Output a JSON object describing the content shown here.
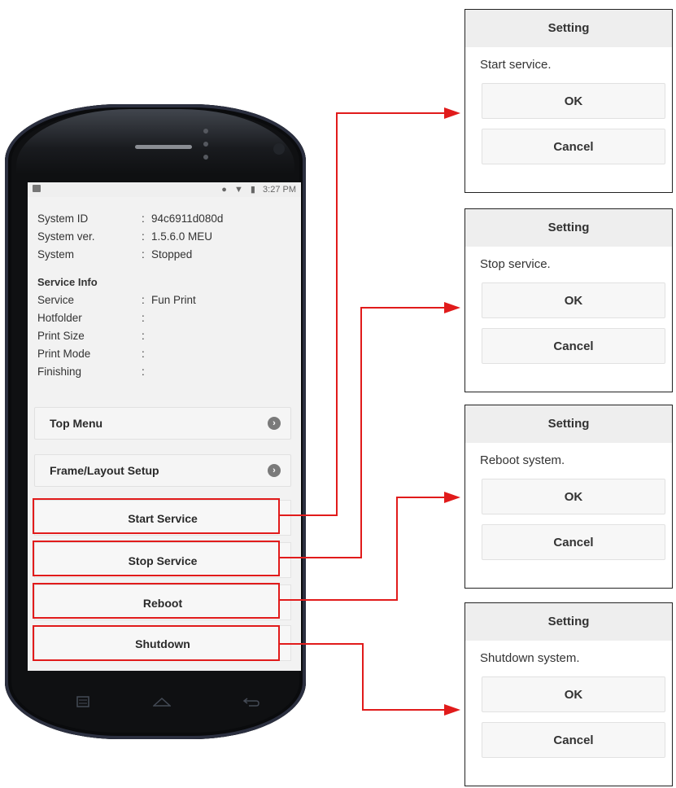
{
  "status_bar": {
    "time": "3:27 PM"
  },
  "system_info": [
    {
      "key": "System ID",
      "sep": ":",
      "value": "94c6911d080d"
    },
    {
      "key": "System ver.",
      "sep": ":",
      "value": "1.5.6.0 MEU"
    },
    {
      "key": "System",
      "sep": ":",
      "value": "Stopped"
    }
  ],
  "service_info": {
    "title": "Service Info",
    "rows": [
      {
        "key": "Service",
        "sep": ":",
        "value": "Fun Print"
      },
      {
        "key": "Hotfolder",
        "sep": ":",
        "value": ""
      },
      {
        "key": "Print Size",
        "sep": ":",
        "value": ""
      },
      {
        "key": "Print Mode",
        "sep": ":",
        "value": ""
      },
      {
        "key": "Finishing",
        "sep": ":",
        "value": ""
      }
    ]
  },
  "menu": {
    "top_menu": "Top Menu",
    "frame_layout": "Frame/Layout Setup"
  },
  "actions": {
    "start": "Start Service",
    "stop": "Stop Service",
    "reboot": "Reboot",
    "shutdown": "Shutdown"
  },
  "dialogs": [
    {
      "title": "Setting",
      "message": "Start service.",
      "ok": "OK",
      "cancel": "Cancel"
    },
    {
      "title": "Setting",
      "message": "Stop service.",
      "ok": "OK",
      "cancel": "Cancel"
    },
    {
      "title": "Setting",
      "message": "Reboot system.",
      "ok": "OK",
      "cancel": "Cancel"
    },
    {
      "title": "Setting",
      "message": "Shutdown system.",
      "ok": "OK",
      "cancel": "Cancel"
    }
  ],
  "colors": {
    "highlight": "#e11b1b",
    "screen_bg": "#f2f2f2",
    "dialog_title_bg": "#eeeeee"
  },
  "icons": [
    "image-icon",
    "notification-icon",
    "wifi-icon",
    "battery-icon",
    "chevron-right-icon",
    "recent-apps-icon",
    "home-icon",
    "back-icon"
  ]
}
